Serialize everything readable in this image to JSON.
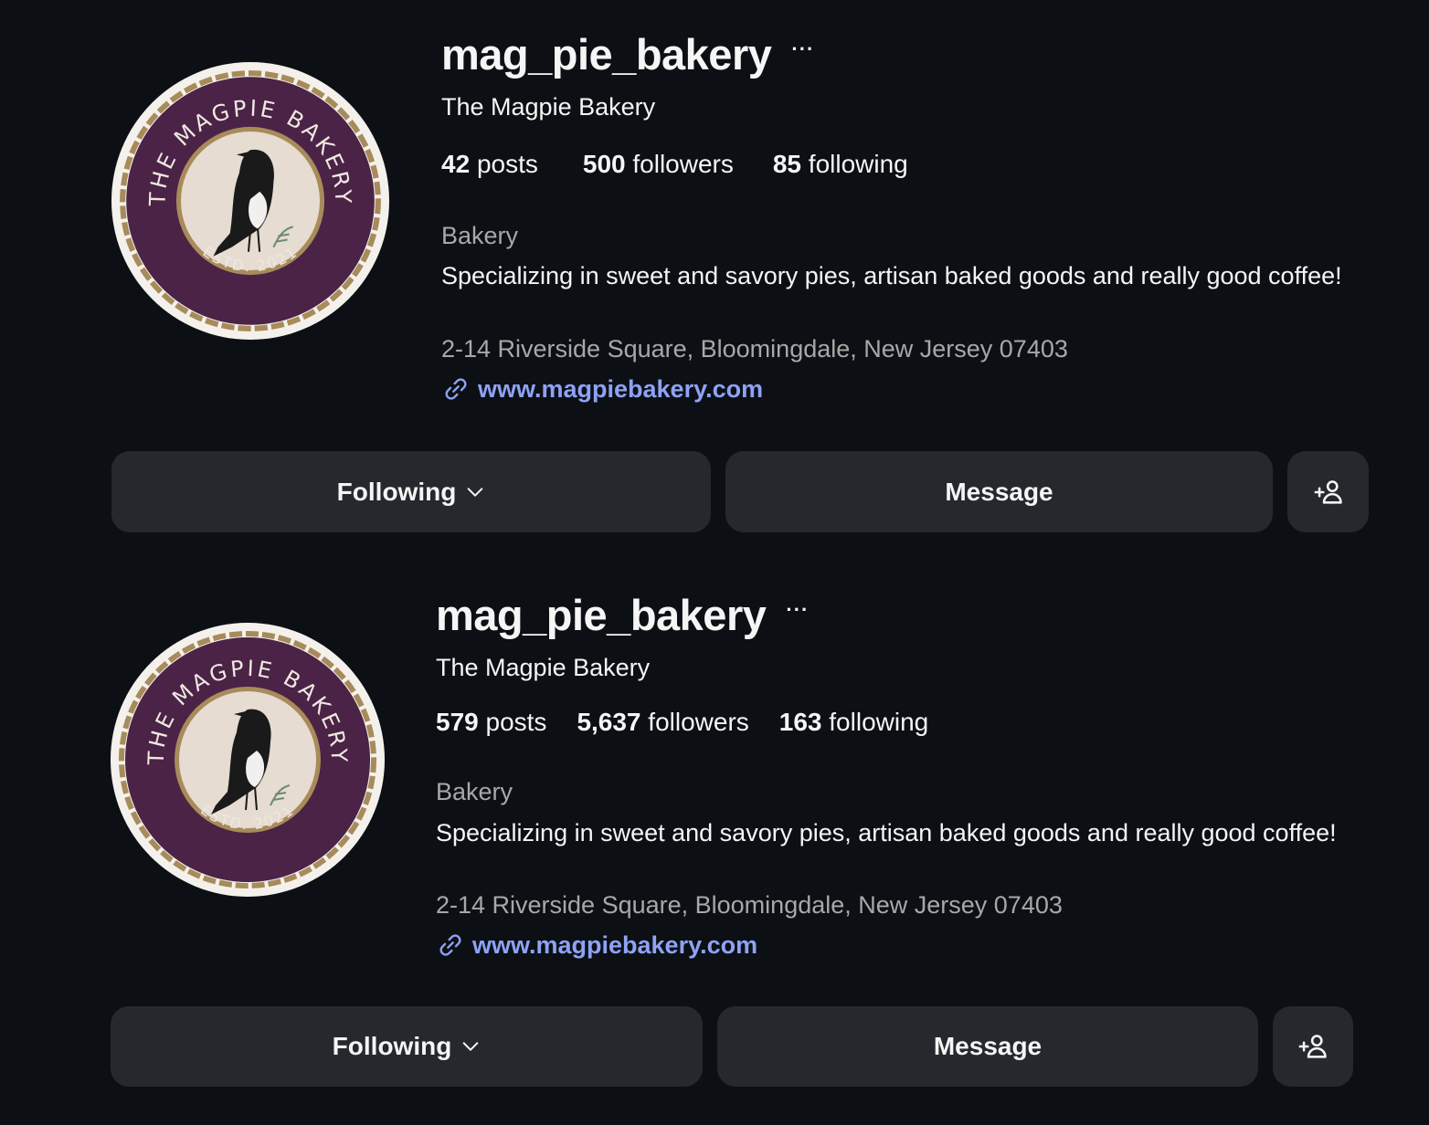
{
  "profiles": [
    {
      "username": "mag_pie_bakery",
      "more_glyph": "···",
      "display_name": "The Magpie Bakery",
      "stats": {
        "posts_count": "42",
        "posts_label": "posts",
        "followers_count": "500",
        "followers_label": "followers",
        "following_count": "85",
        "following_label": "following"
      },
      "category": "Bakery",
      "bio": "Specializing in sweet and savory pies, artisan baked goods and really good coffee!",
      "address": "2-14 Riverside Square, Bloomingdale, New Jersey 07403",
      "website": "www.magpiebakery.com",
      "buttons": {
        "following": "Following",
        "message": "Message"
      },
      "logo": {
        "top_text": "THE MAGPIE BAKERY",
        "bottom_text": "ESTD. 2021"
      }
    },
    {
      "username": "mag_pie_bakery",
      "more_glyph": "···",
      "display_name": "The Magpie Bakery",
      "stats": {
        "posts_count": "579",
        "posts_label": "posts",
        "followers_count": "5,637",
        "followers_label": "followers",
        "following_count": "163",
        "following_label": "following"
      },
      "category": "Bakery",
      "bio": "Specializing in sweet and savory pies, artisan baked goods and really good coffee!",
      "address": "2-14 Riverside Square, Bloomingdale, New Jersey 07403",
      "website": "www.magpiebakery.com",
      "buttons": {
        "following": "Following",
        "message": "Message"
      },
      "logo": {
        "top_text": "THE MAGPIE BAKERY",
        "bottom_text": "ESTD. 2021"
      }
    }
  ],
  "colors": {
    "background": "#0c1014",
    "button_bg": "#25292e",
    "link": "#8ea2f5",
    "secondary_text": "#a8a8a8",
    "logo_purple": "#4a2346",
    "logo_gold": "#a88b5a"
  }
}
